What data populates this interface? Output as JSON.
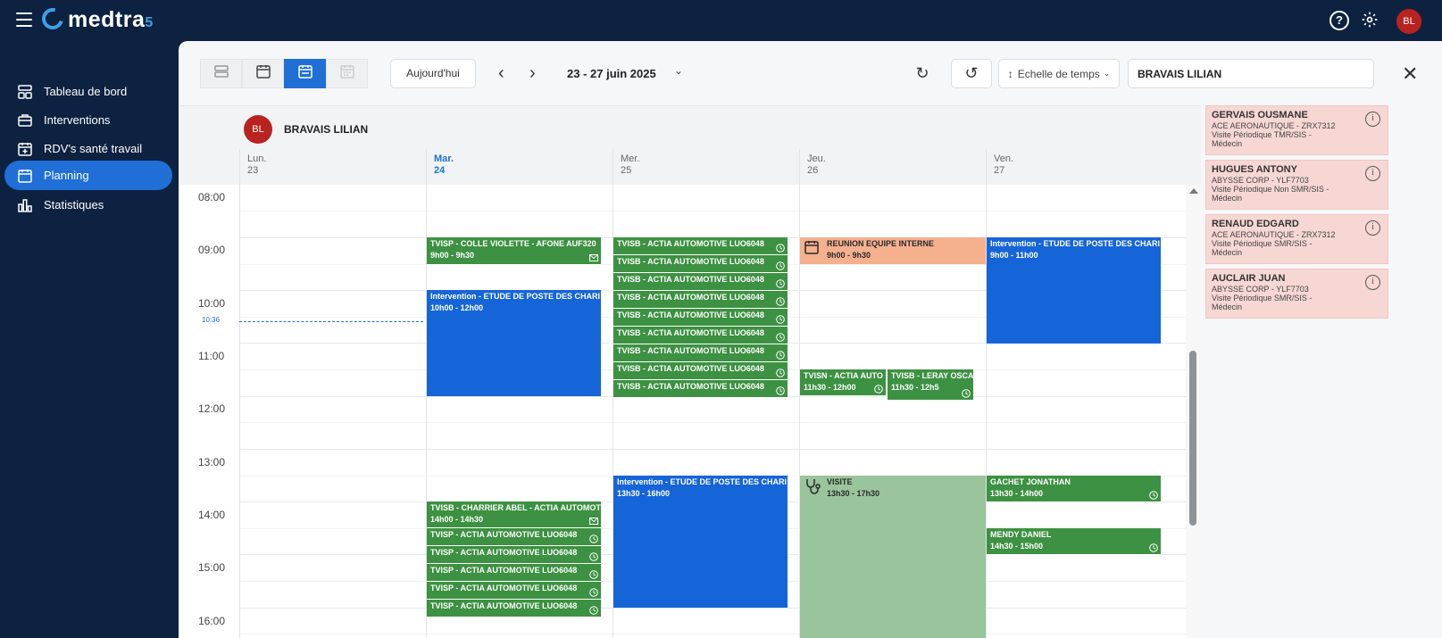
{
  "app": {
    "logo": "medtra",
    "logo_suffix": "5",
    "user_initials": "BL"
  },
  "sidebar": {
    "items": [
      {
        "label": "Tableau de bord",
        "icon": "dashboard-icon",
        "active": false
      },
      {
        "label": "Interventions",
        "icon": "briefcase-icon",
        "active": false
      },
      {
        "label": "RDV's santé travail",
        "icon": "calendar-health-icon",
        "active": false
      },
      {
        "label": "Planning",
        "icon": "calendar-icon",
        "active": true
      },
      {
        "label": "Statistiques",
        "icon": "bar-chart-icon",
        "active": false
      }
    ]
  },
  "toolbar": {
    "today_label": "Aujourd'hui",
    "date_range": "23 - 27 juin 2025",
    "time_scale_label": "Echelle de temps",
    "search_value": "BRAVAIS LILIAN"
  },
  "calendar": {
    "resource": {
      "initials": "BL",
      "name": "BRAVAIS LILIAN"
    },
    "days": [
      {
        "dow": "Lun.",
        "num": "23"
      },
      {
        "dow": "Mar.",
        "num": "24",
        "today": true
      },
      {
        "dow": "Mer.",
        "num": "25"
      },
      {
        "dow": "Jeu.",
        "num": "26"
      },
      {
        "dow": "Ven.",
        "num": "27"
      }
    ],
    "hours": [
      "08:00",
      "09:00",
      "10:00",
      "11:00",
      "12:00",
      "13:00",
      "14:00",
      "15:00",
      "16:00"
    ],
    "now_label": "10:36",
    "events": {
      "tue_0900": {
        "title": "TVISP - COLLE VIOLETTE - AFONE AUF320",
        "time": "9h00 - 9h30"
      },
      "tue_1000": {
        "title": "Intervention - ETUDE DE POSTE DES CHARI",
        "time": "10h00 - 12h00"
      },
      "tue_1400": {
        "title": "TVISB - CHARRIER ABEL - ACTIA AUTOMOT",
        "time": "14h00 - 14h30"
      },
      "tue_list": "TVISP - ACTIA AUTOMOTIVE LUO6048",
      "wed_list": "TVISB - ACTIA AUTOMOTIVE LUO6048",
      "wed_1330": {
        "title": "Intervention - ETUDE DE POSTE DES CHARI",
        "time": "13h30 - 16h00"
      },
      "thu_0900": {
        "title": "REUNION EQUIPE INTERNE",
        "time": "9h00 - 9h30"
      },
      "thu_1130a": {
        "title": "TVISN - ACTIA AUTO",
        "time": "11h30 - 12h00"
      },
      "thu_1130b": {
        "title": "TVISB - LERAY OSCA",
        "time": "11h30 - 12h5"
      },
      "thu_1330": {
        "title": "VISITE",
        "time": "13h30 - 17h30"
      },
      "fri_0900": {
        "title": "Intervention - ETUDE DE POSTE DES CHARI",
        "time": "9h00 - 11h00"
      },
      "fri_1330": {
        "title": "GACHET JONATHAN",
        "time": "13h30 - 14h00"
      },
      "fri_1430": {
        "title": "MENDY DANIEL",
        "time": "14h30 - 15h00"
      }
    }
  },
  "waiting_list": [
    {
      "name": "GERVAIS OUSMANE",
      "company": "ACE AERONAUTIQUE - ZRX7312",
      "visit": "Visite Périodique TMR/SIS -",
      "role": "Médecin"
    },
    {
      "name": "HUGUES ANTONY",
      "company": "ABYSSE CORP - YLF7703",
      "visit": "Visite Périodique Non SMR/SIS -",
      "role": "Médecin"
    },
    {
      "name": "RENAUD EDGARD",
      "company": "ACE AERONAUTIQUE - ZRX7312",
      "visit": "Visite Périodique SMR/SIS -",
      "role": "Médecin"
    },
    {
      "name": "AUCLAIR JUAN",
      "company": "ABYSSE CORP - YLF7703",
      "visit": "Visite Périodique SMR/SIS -",
      "role": "Médecin"
    }
  ],
  "colors": {
    "accent": "#1f6fd6",
    "event_green": "#3d9142",
    "event_blue": "#1665d8",
    "event_orange": "#f5b08e",
    "card_pink": "#f7d7d3",
    "nav_bg": "#0d2240"
  }
}
